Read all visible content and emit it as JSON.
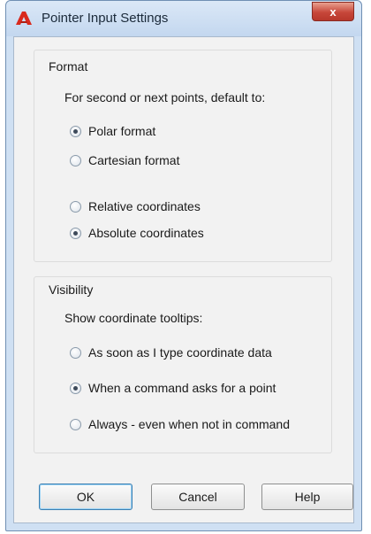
{
  "window": {
    "title": "Pointer Input Settings",
    "close_glyph": "x"
  },
  "format_group": {
    "title": "Format",
    "prompt": "For second or next points, default to:",
    "options_a": [
      {
        "label": "Polar format",
        "checked": true
      },
      {
        "label": "Cartesian format",
        "checked": false
      }
    ],
    "options_b": [
      {
        "label": "Relative coordinates",
        "checked": false
      },
      {
        "label": "Absolute coordinates",
        "checked": true
      }
    ]
  },
  "visibility_group": {
    "title": "Visibility",
    "prompt": "Show coordinate tooltips:",
    "options": [
      {
        "label": "As soon as I type coordinate data",
        "checked": false
      },
      {
        "label": "When a command asks for a point",
        "checked": true
      },
      {
        "label": "Always - even when not in command",
        "checked": false
      }
    ]
  },
  "buttons": {
    "ok": "OK",
    "cancel": "Cancel",
    "help": "Help"
  },
  "colors": {
    "title_bar": "#c3d7ef",
    "close_button": "#c7473a",
    "dialog_background": "#f2f2f2",
    "default_button_border": "#3c7fb1"
  },
  "icons": {
    "app": "autocad-a-icon",
    "close": "close-icon"
  }
}
